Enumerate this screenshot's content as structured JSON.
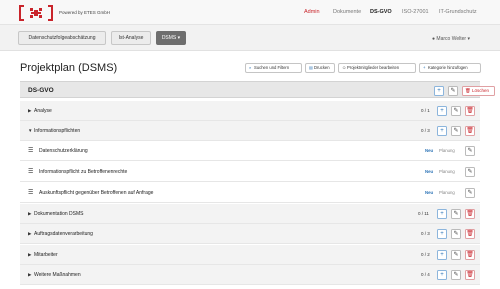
{
  "header": {
    "powered_by": "Powered by ETES GmbH",
    "nav": [
      {
        "label": "Admin",
        "state": "active"
      },
      {
        "label": "Dokumente",
        "state": "normal"
      },
      {
        "label": "DS-GVO",
        "state": "current"
      },
      {
        "label": "ISO-27001",
        "state": "normal"
      },
      {
        "label": "IT-Grundschutz",
        "state": "normal"
      }
    ]
  },
  "subnav": {
    "tabs": [
      "Datenschutzfolgeabschätzung",
      "Ist-Analyse",
      "DSMS"
    ],
    "dsms_caret": "▾",
    "user": "Marco Welter"
  },
  "page": {
    "title": "Projektplan (DSMS)",
    "actions": {
      "search": "Suchen und Filtern",
      "print": "Drucken",
      "members": "Projektmitglieder bearbeiten",
      "add_category": "Kategorie hinzufügen"
    }
  },
  "table": {
    "header": "DS-GVO",
    "delete_label": "Löschen",
    "rows": [
      {
        "label": "Analyse",
        "count": "0 / 1",
        "expanded": false,
        "type": "category"
      },
      {
        "label": "Informationspflichten",
        "count": "0 / 3",
        "expanded": true,
        "type": "category"
      },
      {
        "label": "Datenschutzerklärung",
        "badge": "Neu",
        "status": "Planung",
        "type": "task"
      },
      {
        "label": "Informationspflicht zu Betroffenenrechte",
        "badge": "Neu",
        "status": "Planung",
        "type": "task"
      },
      {
        "label": "Auskunftspflicht gegenüber Betroffenen auf Anfrage",
        "badge": "Neu",
        "status": "Planung",
        "type": "task"
      },
      {
        "label": "Dokumentation DSMS",
        "count": "0 / 11",
        "expanded": false,
        "type": "category"
      },
      {
        "label": "Auftragsdatenverarbeitung",
        "count": "0 / 3",
        "expanded": false,
        "type": "category"
      },
      {
        "label": "Mitarbeiter",
        "count": "0 / 2",
        "expanded": false,
        "type": "category"
      },
      {
        "label": "Weitere Maßnahmen",
        "count": "0 / 4",
        "expanded": false,
        "type": "category"
      }
    ]
  },
  "colors": {
    "brand_red": "#c9242b",
    "link_blue": "#2b73b6"
  }
}
